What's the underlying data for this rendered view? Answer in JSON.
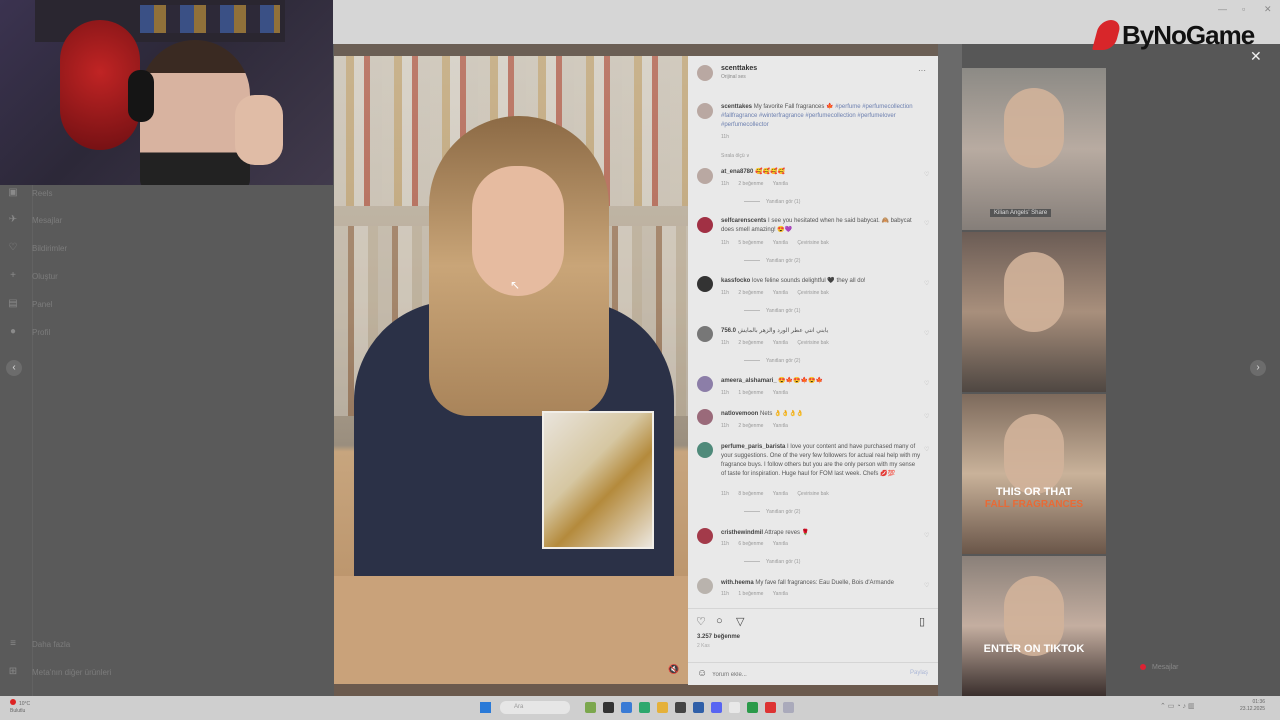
{
  "left_nav": {
    "items": [
      {
        "label": "Reels",
        "icon": "reels-icon"
      },
      {
        "label": "Mesajlar",
        "icon": "messages-icon"
      },
      {
        "label": "Bildirimler",
        "icon": "heart-icon"
      },
      {
        "label": "Oluştur",
        "icon": "plus-icon"
      },
      {
        "label": "Panel",
        "icon": "dashboard-icon"
      },
      {
        "label": "Profil",
        "icon": "profile-icon"
      }
    ],
    "more_label": "Daha fazla",
    "meta_label": "Meta'nın diğer ürünleri"
  },
  "logo": {
    "text": "ByNoGame",
    "color": "#d8262a"
  },
  "post_panel": {
    "header_user": "scenttakes",
    "header_sub": "Orijinal ses",
    "caption_user": "scenttakes",
    "caption_text": "My favorite Fall fragrances 🍁",
    "caption_tags": "#perfume #perfumecollection #fallfragrance #winterfragrance #perfumecollection #perfumelover #perfumecollector",
    "caption_time": "11h",
    "sort_label": "Sırala ölçü ∨",
    "comments": [
      {
        "user": "at_ena8780",
        "text": "🥰🥰🥰🥰",
        "time": "11h",
        "likes": "2 beğenme",
        "reply": "Yanıtla",
        "translate": "",
        "replies": "Yanıtları gör (1)"
      },
      {
        "user": "selfcarenscents",
        "text": "I see you hesitated when he said babycat. 🙈 babycat does smell amazing! 😍💜",
        "time": "11h",
        "likes": "5 beğenme",
        "reply": "Yanıtla",
        "translate": "Çevirisine bak",
        "replies": "Yanıtları gör (2)"
      },
      {
        "user": "kassfocko",
        "text": "love feline sounds delightful 🖤 they all do!",
        "time": "11h",
        "likes": "2 beğenme",
        "reply": "Yanıtla",
        "translate": "Çevirisine bak",
        "replies": "Yanıtları gör (1)"
      },
      {
        "user": "756.0",
        "text": "يابني انتي عطر الورد والزهر بالمايش",
        "time": "11h",
        "likes": "2 beğenme",
        "reply": "Yanıtla",
        "translate": "Çevirisine bak",
        "replies": "Yanıtları gör (2)"
      },
      {
        "user": "ameera_alshamari_",
        "text": "😍🍁😍🍁😍🍁",
        "time": "11h",
        "likes": "1 beğenme",
        "reply": "Yanıtla",
        "translate": "",
        "replies": ""
      },
      {
        "user": "natlovemoon",
        "text": "Nets 👌👌👌👌",
        "time": "11h",
        "likes": "2 beğenme",
        "reply": "Yanıtla",
        "translate": "",
        "replies": ""
      },
      {
        "user": "perfume_paris_barista",
        "text": "I love your content and have purchased many of your suggestions. One of the very few followers for actual real help with my fragrance buys. I follow others but you are the only person with my sense of taste for inspiration. Huge haul for FOM last week. Chefs 💋💯",
        "time": "11h",
        "likes": "8 beğenme",
        "reply": "Yanıtla",
        "translate": "Çevirisine bak",
        "replies": "Yanıtları gör (2)"
      },
      {
        "user": "cristhewindmil",
        "text": "Attrape reves 🌹",
        "time": "11h",
        "likes": "6 beğenme",
        "reply": "Yanıtla",
        "translate": "",
        "replies": "Yanıtları gör (1)"
      },
      {
        "user": "with.heema",
        "text": "My fave fall fragrances: Eau Duelle, Bois d'Armande",
        "time": "11h",
        "likes": "1 beğenme",
        "reply": "Yanıtla",
        "translate": "",
        "replies": ""
      }
    ],
    "likes_count": "3.257 beğenme",
    "likes_date": "2 Kas",
    "comment_placeholder": "Yorum ekle...",
    "post_label": "Paylaş"
  },
  "thumbs": {
    "t1_caption": "Kilian Angels' Share",
    "t3_line1": "THIS OR THAT",
    "t3_line2": "FALL FRAGRANCES",
    "t4_line": "ENTER ON TIKTOK"
  },
  "messages_pill": {
    "label": "Mesajlar"
  },
  "taskbar": {
    "weather_line1": "10°C",
    "weather_line2": "Bulutlu",
    "search_placeholder": "Ara",
    "time": "01:36",
    "date": "23.12.2025"
  },
  "colors": {
    "accent": "#d8262a",
    "panel_bg": "#e9e9e9"
  }
}
